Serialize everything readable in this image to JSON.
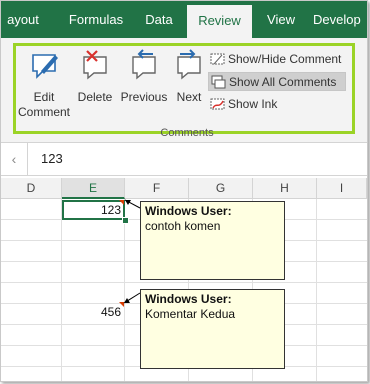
{
  "ribbon": {
    "tabs": [
      {
        "label": "ayout"
      },
      {
        "label": "Formulas"
      },
      {
        "label": "Data"
      },
      {
        "label": "Review"
      },
      {
        "label": "View"
      },
      {
        "label": "Develop"
      }
    ],
    "active_tab": "Review",
    "buttons": {
      "edit_comment": "Edit\nComment",
      "edit_line1": "Edit",
      "edit_line2": "Comment",
      "delete": "Delete",
      "previous": "Previous",
      "next": "Next"
    },
    "small_buttons": {
      "show_hide": "Show/Hide Comment",
      "show_all": "Show All Comments",
      "show_ink": "Show Ink"
    },
    "group_label": "Comments",
    "colors": {
      "tab_bar": "#217346",
      "highlight_border": "#9bd326",
      "comment_bg": "#ffffe1"
    }
  },
  "formula_bar": {
    "value": "123"
  },
  "sheet": {
    "columns": [
      "D",
      "E",
      "F",
      "G",
      "H",
      "I"
    ],
    "selected_column": "E",
    "cells": {
      "e_row1": "123",
      "e_row6": "456"
    }
  },
  "comments": [
    {
      "author": "Windows User:",
      "text": "contoh komen"
    },
    {
      "author": "Windows User:",
      "text": "Komentar Kedua"
    }
  ]
}
